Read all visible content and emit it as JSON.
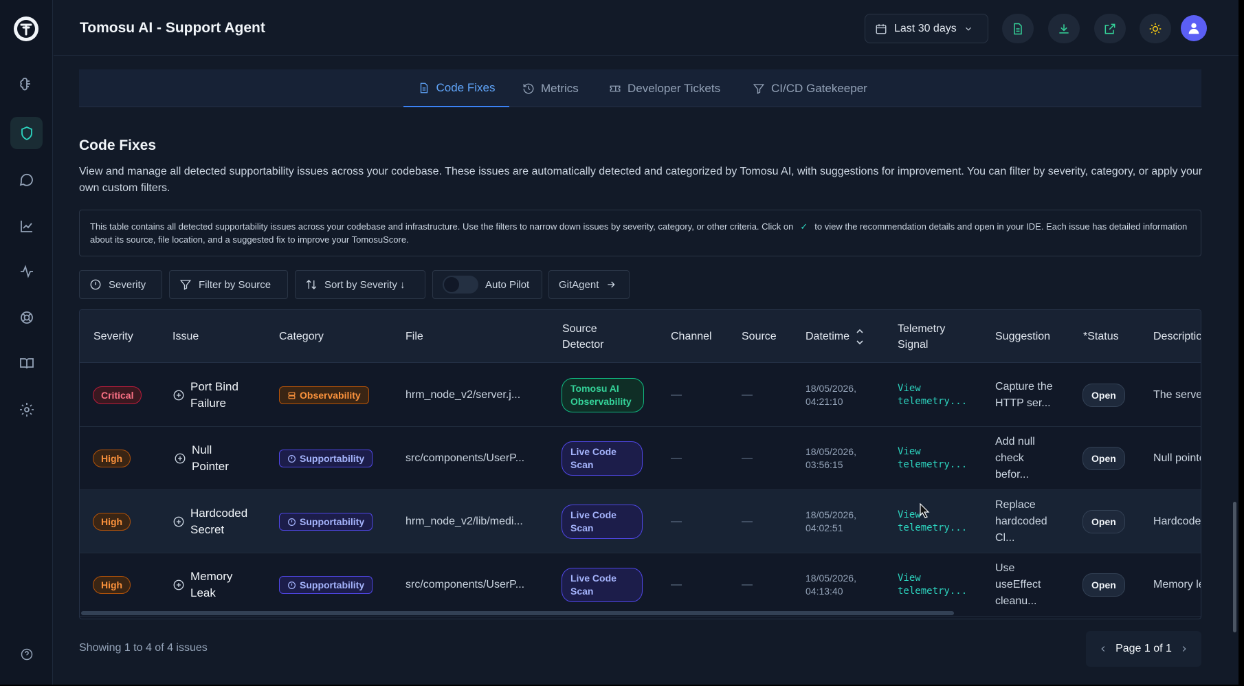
{
  "header": {
    "title": "Tomosu AI - Support Agent",
    "date_range": "Last 30 days"
  },
  "tabs": [
    "Code Fixes",
    "Metrics",
    "Developer Tickets",
    "CI/CD Gatekeeper"
  ],
  "section": {
    "title": "Code Fixes",
    "description": "View and manage all detected supportability issues across your codebase. These issues are automatically detected and categorized by Tomosu AI, with suggestions for improvement. You can filter by severity, category, or apply your own custom filters.",
    "info_part1": "This table contains all detected supportability issues across your codebase and infrastructure. Use the filters to narrow down issues by severity, category, or other criteria. Click on",
    "info_part2": "to view the recommendation details and open in your IDE. Each issue has detailed information about its source, file location, and a suggested fix to improve your TomosuScore."
  },
  "filters": {
    "severity": "Severity",
    "source": "Filter by Source",
    "sort": "Sort by Severity ↓",
    "autopilot": "Auto Pilot",
    "gitagent": "GitAgent"
  },
  "table": {
    "columns": [
      "Severity",
      "Issue",
      "Category",
      "File",
      "Source Detector",
      "Channel",
      "Source",
      "Datetime",
      "Telemetry Signal",
      "Suggestion",
      "*Status",
      "Descriptio"
    ],
    "rows": [
      {
        "severity": "Critical",
        "issue": "Port Bind Failure",
        "category": "Observability",
        "file": "hrm_node_v2/server.j...",
        "detector": "Tomosu AI Observability",
        "channel": "—",
        "source": "—",
        "datetime": "18/05/2026, 04:21:10",
        "telemetry": "View telemetry...",
        "suggestion": "Capture the HTTP ser...",
        "status": "Open",
        "description": "The serve"
      },
      {
        "severity": "High",
        "issue": "Null Pointer",
        "category": "Supportability",
        "file": "src/components/UserP...",
        "detector": "Live Code Scan",
        "channel": "—",
        "source": "—",
        "datetime": "18/05/2026, 03:56:15",
        "telemetry": "View telemetry...",
        "suggestion": "Add null check befor...",
        "status": "Open",
        "description": "Null pointe"
      },
      {
        "severity": "High",
        "issue": "Hardcoded Secret",
        "category": "Supportability",
        "file": "hrm_node_v2/lib/medi...",
        "detector": "Live Code Scan",
        "channel": "—",
        "source": "—",
        "datetime": "18/05/2026, 04:02:51",
        "telemetry": "View telemetry...",
        "suggestion": "Replace hardcoded Cl...",
        "status": "Open",
        "description": "Hardcode"
      },
      {
        "severity": "High",
        "issue": "Memory Leak",
        "category": "Supportability",
        "file": "src/components/UserP...",
        "detector": "Live Code Scan",
        "channel": "—",
        "source": "—",
        "datetime": "18/05/2026, 04:13:40",
        "telemetry": "View telemetry...",
        "suggestion": "Use useEffect cleanu...",
        "status": "Open",
        "description": "Memory le"
      }
    ]
  },
  "footer": {
    "showing": "Showing 1 to 4 of 4 issues",
    "page": "Page 1 of 1"
  },
  "colors": {
    "accent": "#3b82f6",
    "teal": "#2dd4bf",
    "critical": "#fb7185",
    "high": "#fb923c",
    "background": "#121a28"
  }
}
